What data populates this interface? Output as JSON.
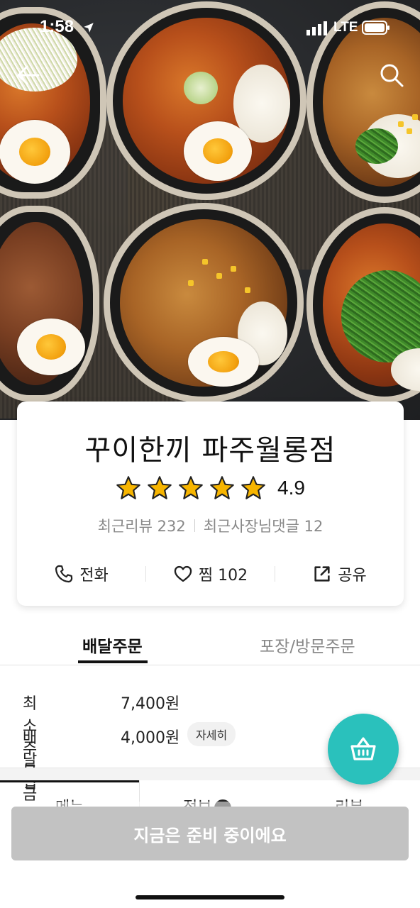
{
  "status_bar": {
    "time": "1:58",
    "network": "LTE"
  },
  "store": {
    "name": "꾸이한끼 파주월롱점",
    "rating": "4.9",
    "star_count": 5,
    "recent_reviews": "최근리뷰 232",
    "owner_replies": "최근사장님댓글 12"
  },
  "actions": {
    "call": "전화",
    "like": "찜 102",
    "share": "공유"
  },
  "order_tabs": {
    "delivery": "배달주문",
    "pickup": "포장/방문주문"
  },
  "delivery_info": {
    "min_order_label": "최소주문금액",
    "min_order_value": "7,400원",
    "tip_label": "배달팁",
    "tip_value": "4,000원",
    "detail_label": "자세히"
  },
  "content_tabs": {
    "menu": "메뉴",
    "info": "정보",
    "review": "리뷰"
  },
  "bottom_button": "지금은 준비 중이에요",
  "colors": {
    "accent": "#2ac1bc",
    "star": "#f7b500",
    "disabled": "#c2c2c2"
  },
  "icons": {
    "back": "arrow-left-icon",
    "search": "search-icon",
    "call": "phone-icon",
    "like": "heart-icon",
    "share": "share-icon",
    "cart": "basket-icon"
  }
}
